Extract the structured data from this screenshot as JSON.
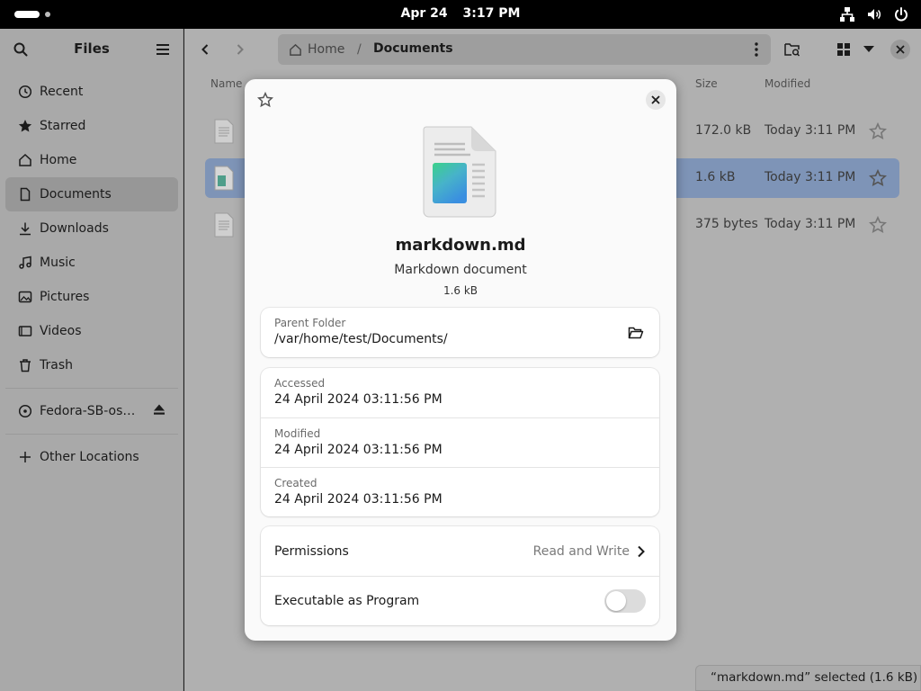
{
  "topbar": {
    "date": "Apr 24",
    "time": "3:17 PM",
    "icons": [
      "network-icon",
      "volume-icon",
      "power-icon"
    ]
  },
  "sidebar": {
    "title": "Files",
    "items": [
      {
        "label": "Recent",
        "icon": "clock-icon"
      },
      {
        "label": "Starred",
        "icon": "star-icon"
      },
      {
        "label": "Home",
        "icon": "home-icon"
      },
      {
        "label": "Documents",
        "icon": "document-icon",
        "active": true
      },
      {
        "label": "Downloads",
        "icon": "download-icon"
      },
      {
        "label": "Music",
        "icon": "music-icon"
      },
      {
        "label": "Pictures",
        "icon": "picture-icon"
      },
      {
        "label": "Videos",
        "icon": "video-icon"
      },
      {
        "label": "Trash",
        "icon": "trash-icon"
      }
    ],
    "drive": {
      "label": "Fedora-SB-os…",
      "icon": "disc-icon"
    },
    "other": {
      "label": "Other Locations",
      "icon": "plus-icon"
    }
  },
  "pathbar": {
    "home": "Home",
    "separator": "/",
    "current": "Documents"
  },
  "columns": {
    "name": "Name",
    "size": "Size",
    "modified": "Modified"
  },
  "files": [
    {
      "size": "172.0 kB",
      "modified": "Today 3:11 PM"
    },
    {
      "size": "1.6 kB",
      "modified": "Today 3:11 PM",
      "selected": true
    },
    {
      "size": "375 bytes",
      "modified": "Today 3:11 PM"
    }
  ],
  "status": "“markdown.md” selected  (1.6 kB)",
  "dialog": {
    "name": "markdown.md",
    "type": "Markdown document",
    "size": "1.6 kB",
    "parent_folder_label": "Parent Folder",
    "parent_folder": "/var/home/test/Documents/",
    "accessed_label": "Accessed",
    "accessed": "24 April 2024 03:11:56 PM",
    "modified_label": "Modified",
    "modified": "24 April 2024 03:11:56 PM",
    "created_label": "Created",
    "created": "24 April 2024 03:11:56 PM",
    "permissions_label": "Permissions",
    "permissions_value": "Read and Write",
    "executable_label": "Executable as Program",
    "executable": false
  },
  "colors": {
    "accent_selected": "#7e94b7",
    "dialog_bg": "#fafafa",
    "topbar_bg": "#000000"
  }
}
